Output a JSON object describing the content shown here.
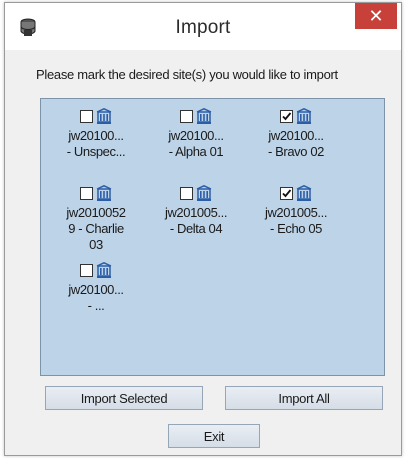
{
  "window": {
    "title": "Import",
    "close_label": "✕"
  },
  "instructions": "Please mark the desired site(s) you would like to import",
  "sites": [
    {
      "label": "jw20100...\n- Unspec...",
      "checked": false
    },
    {
      "label": "jw20100...\n- Alpha 01",
      "checked": false
    },
    {
      "label": "jw20100...\n- Bravo 02",
      "checked": true
    },
    {
      "label": "jw2010052\n9 - Charlie\n03",
      "checked": false
    },
    {
      "label": "jw201005...\n- Delta 04",
      "checked": false
    },
    {
      "label": "jw201005...\n- Echo 05",
      "checked": true
    },
    {
      "label": "jw20100...\n- ...",
      "checked": false
    }
  ],
  "buttons": {
    "import_selected": "Import Selected",
    "import_all": "Import All",
    "exit": "Exit"
  },
  "colors": {
    "panel_bg": "#bcd3e8",
    "close_bg": "#c7403a",
    "building_icon": "#2c5ea8"
  },
  "icons": {
    "app": "database-icon",
    "site": "building-icon",
    "close": "close-icon"
  }
}
